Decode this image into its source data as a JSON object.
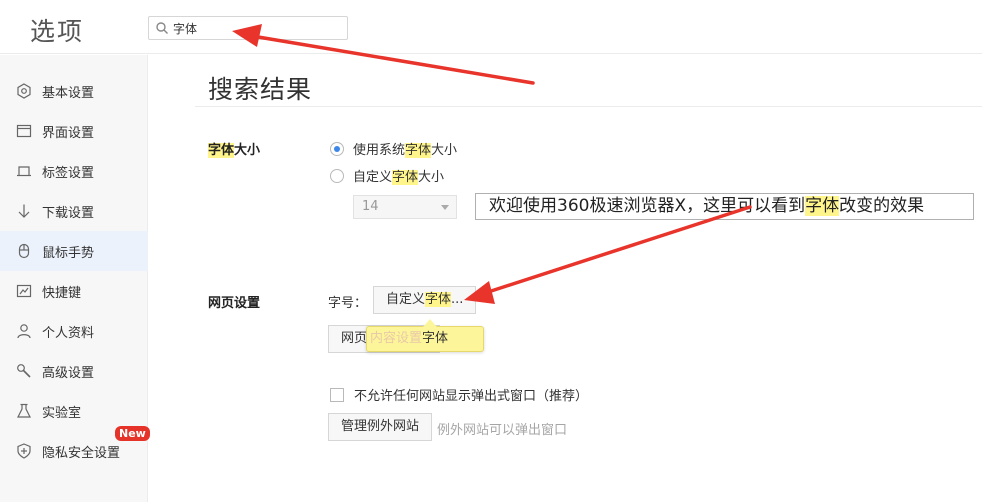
{
  "header": {
    "app_title": "选项",
    "search": {
      "value": "字体",
      "placeholder": ""
    }
  },
  "sidebar": {
    "items": [
      {
        "label": "基本设置",
        "icon": "settings-icon"
      },
      {
        "label": "界面设置",
        "icon": "window-icon"
      },
      {
        "label": "标签设置",
        "icon": "tab-icon"
      },
      {
        "label": "下载设置",
        "icon": "download-icon"
      },
      {
        "label": "鼠标手势",
        "icon": "mouse-icon"
      },
      {
        "label": "快捷键",
        "icon": "shortcut-icon"
      },
      {
        "label": "个人资料",
        "icon": "person-icon"
      },
      {
        "label": "高级设置",
        "icon": "wrench-icon"
      },
      {
        "label": "实验室",
        "icon": "flask-icon"
      },
      {
        "label": "隐私安全设置",
        "icon": "shield-icon"
      }
    ],
    "active_index": 4,
    "new_badge": "New"
  },
  "main": {
    "title": "搜索结果",
    "font_size_section": {
      "label_hl": "字体",
      "label_rest": "大小",
      "option_system_pre": "使用系统",
      "option_system_hl": "字体",
      "option_system_post": "大小",
      "option_custom_pre": "自定义",
      "option_custom_hl": "字体",
      "option_custom_post": "大小",
      "size_value": "14",
      "preview_pre": "欢迎使用360极速浏览器X，这里可以看到",
      "preview_hl": "字体",
      "preview_post": "改变的效果"
    },
    "webpage_section": {
      "label": "网页设置",
      "font_label": "字号：",
      "custom_font_button_pre": "自定义",
      "custom_font_button_hl": "字体",
      "custom_font_button_post": "...",
      "content_button_visible": "网页",
      "tooltip_faint": "内容设置",
      "tooltip_text": "字体",
      "popup_block_label": "不允许任何网站显示弹出式窗口（推荐）",
      "manage_exceptions_button": "管理例外网站",
      "exceptions_hint": "例外网站可以弹出窗口"
    }
  },
  "colors": {
    "highlight": "#fff58a",
    "accent_blue": "#3d87e8",
    "annotation_red": "#e8342b",
    "badge_red": "#e5332a"
  }
}
